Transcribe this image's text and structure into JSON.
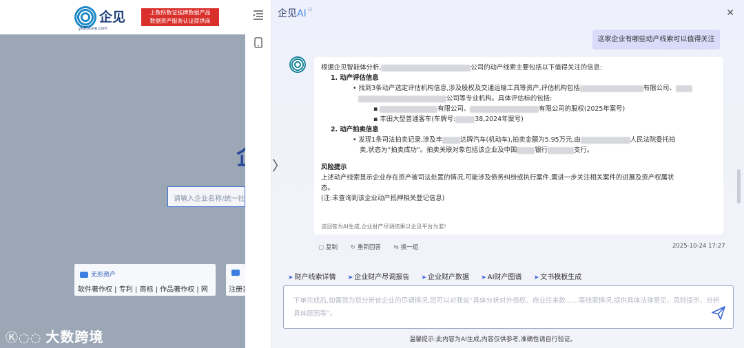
{
  "background": {
    "brand": "企见",
    "domain": "yidfuture.com",
    "badge_lines": [
      "上数所数证挂牌数据产品",
      "数据资产服务认证提供商"
    ],
    "big_char": "企",
    "search_placeholder": "请输入企业名称/统一社",
    "cards": [
      {
        "title": "无形资产",
        "links": "软件著作权 | 专利 | 商标 | 作品著作权 | 网"
      },
      {
        "title": "",
        "links": "注册资"
      }
    ],
    "watermark_mark": "Ⓚ◌◌",
    "watermark": "大数跨境"
  },
  "panel": {
    "title_main": "企见",
    "title_ai": "AI",
    "title_sup": "⊙",
    "user_message": "这家企业有哪些动产线索可以值得关注",
    "answer": {
      "intro_a": "根据企见智能体分析,",
      "intro_b": "公司的动产线索主要包括以下值得关注的信息:",
      "sec1_title": "1.  动产评估信息",
      "sec1_item_a": "•  找到3条动产选定评估机构信息,涉及股权及交通运输工具等资产,评估机构包括",
      "sec1_item_b": "有限公司、",
      "sec1_item_c": "公司等专业机构。具体评估标的包括:",
      "sec1_sub1_a": "▪",
      "sec1_sub1_b": "有限公司、",
      "sec1_sub1_c": "有限公司的股权(2025年案号)",
      "sec1_sub2_a": "▪  丰田大型普通客车(车牌号:",
      "sec1_sub2_b": "38,2024年案号)",
      "sec2_title": "2.  动产拍卖信息",
      "sec2_item_a": "•  发现1条司法拍卖记录,涉及丰",
      "sec2_item_b": "达牌汽车(机动车),拍卖金额为5.95万元,由",
      "sec2_item_c": "人民法院委托拍",
      "sec2_item_d": "卖,状态为“拍卖成功”。拍卖关联对象包括该企业及中国",
      "sec2_item_e": "银行",
      "sec2_item_f": "支行。",
      "risk_title": "风险提示",
      "risk_line1": "上述动产线索显示企业存在资产被司法处置的情况,可能涉及债务纠纷或执行案件,需进一步关注相关案件的进展及资产权属状",
      "risk_line2": "态。",
      "risk_note": "(注:未查询到该企业动产抵押相关登记信息)",
      "disclaimer": "该回答为AI生成,企业财产尽调结果以企见平台为准!"
    },
    "actions": [
      {
        "icon": "▢",
        "label": "复制"
      },
      {
        "icon": "↻",
        "label": "重新回答"
      },
      {
        "icon": "⇆",
        "label": "换一组"
      }
    ],
    "timestamp": "2025-10-24  17:27",
    "quick_links": [
      "财产线索详情",
      "企业财产尽调报告",
      "企业财产数据",
      "AI财产图谱",
      "文书模板生成"
    ],
    "input_placeholder": "下单完成后,如需我为您分析该企业的尽调情况,您可以对我说“具体分析对外债权、商业往来款……等线索情况,提供具体法律意见、风险提示、分析具体原因等”。",
    "footer_tip": "温馨提示:此内容为AI生成,内容仅供参考,准确性请自行验证。"
  },
  "colors": {
    "accent": "#3a66d6",
    "user_bubble": "#d8dcf8",
    "badge_red": "#d9302c"
  }
}
